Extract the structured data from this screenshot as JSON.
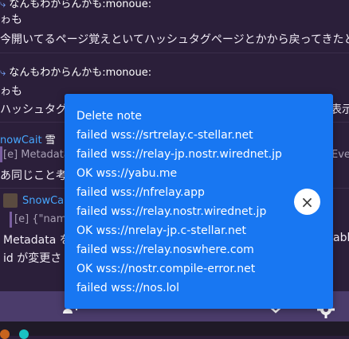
{
  "timeline": {
    "post1": {
      "author": "なんもわからんかも:monoue:",
      "line1": "ゎも",
      "line2": "今開いてるページ覚えといてハッシュタグページとかから戻ってきたときもの"
    },
    "post2": {
      "author": "なんもわからんかも:monoue:",
      "line1": "ゎも",
      "line2": "ハッシュタグから"
    },
    "post3": {
      "author": "nowCait",
      "author_suffix": "雪",
      "meta": "[e] Metadata",
      "text": "あ同じこと考"
    },
    "post4": {
      "author": "SnowCa",
      "meta": "[e] {\"name",
      "line1": "Metadata を",
      "line2": "id が変更さ"
    },
    "right_fragments": {
      "f1": "表示",
      "f2": "Eve",
      "f3": "abl"
    }
  },
  "nav": {
    "icons": [
      "people-plus-icon",
      "chevron-down-icon",
      "gear-icon"
    ]
  },
  "toast": {
    "title": "Delete note",
    "lines": [
      "failed wss://srtrelay.c-stellar.net",
      "failed wss://relay-jp.nostr.wirednet.jp",
      "OK wss://yabu.me",
      "failed wss://nfrelay.app",
      "failed wss://relay.nostr.wirednet.jp",
      "OK wss://nrelay-jp.c-stellar.net",
      "failed wss://relay.noswhere.com",
      "OK wss://nostr.compile-error.net",
      "failed wss://nos.lol"
    ],
    "close_glyph": "×"
  },
  "colors": {
    "toast_bg": "#1877f2",
    "nav_bg": "#4b3c6b",
    "page_bg": "#2b1f3a",
    "link": "#46a7ff"
  }
}
